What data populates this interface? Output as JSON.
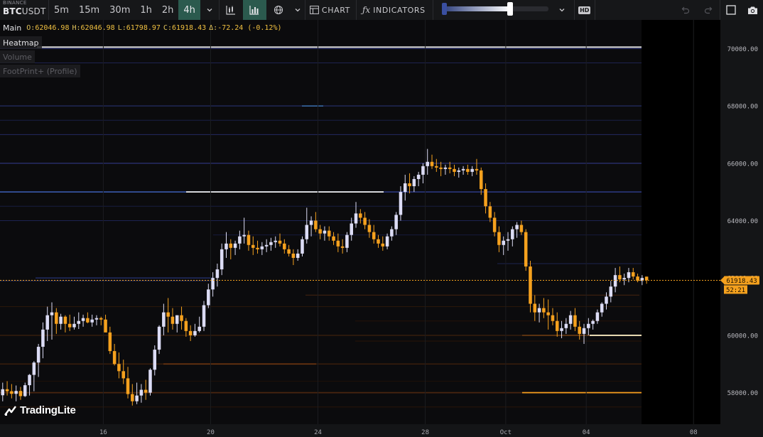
{
  "toolbar": {
    "exchange": "BINANCE",
    "symbol_base": "BTC",
    "symbol_quote": "USDT",
    "timeframes": [
      "5m",
      "15m",
      "30m",
      "1h",
      "2h",
      "4h"
    ],
    "active_timeframe": "4h",
    "chart_label": "CHART",
    "indicators_label": "INDICATORS",
    "hd_badge": "HD",
    "heatmap_slider_level": 0.64
  },
  "legend": {
    "main_label": "Main",
    "o_label": "O:",
    "o_value": "62046.98",
    "h_label": "H:",
    "h_value": "62046.98",
    "l_label": "L:",
    "l_value": "61798.97",
    "c_label": "C:",
    "c_value": "61918.43",
    "d_label": "Δ:",
    "d_value": "-72.24 (-0.12%)"
  },
  "layers": [
    {
      "label": "Heatmap",
      "enabled": true
    },
    {
      "label": "Volume",
      "enabled": false
    },
    {
      "label": "FootPrint+ (Profile)",
      "enabled": false
    }
  ],
  "brand": "TradingLite",
  "colors": {
    "up": "#dcdcf5",
    "down": "#f5a11e",
    "background": "#0b0b0d",
    "toolbar": "#161719",
    "active": "#2b5a4e",
    "price_line": "#f5a11e"
  },
  "chart_data": {
    "type": "candlestick",
    "y_ticks": [
      "58000.00",
      "60000.00",
      "62000.00",
      "64000.00",
      "66000.00",
      "68000.00",
      "70000.00"
    ],
    "y_tick_values": [
      58000,
      60000,
      62000,
      64000,
      66000,
      68000,
      70000
    ],
    "x_ticks": [
      "16",
      "20",
      "24",
      "28",
      "Oct",
      "04",
      "08"
    ],
    "x_tick_days": [
      16,
      20,
      24,
      28,
      31,
      34,
      38
    ],
    "ylim": [
      56900,
      71000
    ],
    "xlim_days": [
      12.15,
      39.0
    ],
    "last_price": "61918.43",
    "countdown": "52:21",
    "candles_per_day": 6,
    "first_candle_day": 12.25,
    "ohlc": [
      [
        57910,
        58350,
        57700,
        58120
      ],
      [
        58120,
        58400,
        57900,
        58050
      ],
      [
        58050,
        58300,
        57800,
        57960
      ],
      [
        57960,
        58250,
        57700,
        58060
      ],
      [
        58060,
        58200,
        57750,
        57880
      ],
      [
        57880,
        58350,
        57850,
        58260
      ],
      [
        58260,
        58650,
        57900,
        58620
      ],
      [
        58620,
        59100,
        58050,
        59050
      ],
      [
        59050,
        59700,
        58550,
        59600
      ],
      [
        59600,
        60450,
        59200,
        60200
      ],
      [
        60200,
        61000,
        59800,
        60700
      ],
      [
        60700,
        61150,
        59850,
        60800
      ],
      [
        60800,
        60950,
        60050,
        60400
      ],
      [
        60400,
        60750,
        60200,
        60650
      ],
      [
        60650,
        60700,
        60100,
        60400
      ],
      [
        60400,
        60720,
        60150,
        60280
      ],
      [
        60280,
        60650,
        60200,
        60400
      ],
      [
        60400,
        60800,
        60220,
        60500
      ],
      [
        60500,
        60720,
        60300,
        60600
      ],
      [
        60600,
        60800,
        60420,
        60450
      ],
      [
        60450,
        60720,
        60300,
        60550
      ],
      [
        60550,
        60700,
        60350,
        60600
      ],
      [
        60600,
        60650,
        60350,
        60550
      ],
      [
        60550,
        60720,
        60250,
        60100
      ],
      [
        60100,
        60300,
        59350,
        59450
      ],
      [
        59450,
        59700,
        58950,
        59000
      ],
      [
        59000,
        59400,
        58500,
        58750
      ],
      [
        58750,
        59150,
        58300,
        58500
      ],
      [
        58500,
        58900,
        57800,
        57950
      ],
      [
        57950,
        58300,
        57550,
        57700
      ],
      [
        57700,
        58350,
        57600,
        57900
      ],
      [
        57900,
        58300,
        57650,
        58100
      ],
      [
        58100,
        58450,
        57750,
        58000
      ],
      [
        58000,
        58850,
        57900,
        58800
      ],
      [
        58800,
        59650,
        58600,
        59500
      ],
      [
        59500,
        60350,
        59350,
        60300
      ],
      [
        60300,
        61100,
        60000,
        60800
      ],
      [
        60800,
        61300,
        60100,
        60650
      ],
      [
        60650,
        60950,
        60200,
        60400
      ],
      [
        60400,
        60700,
        60100,
        60700
      ],
      [
        60700,
        61000,
        60200,
        60500
      ],
      [
        60500,
        60600,
        59950,
        60150
      ],
      [
        60150,
        60350,
        59800,
        60000
      ],
      [
        60000,
        60400,
        59950,
        60150
      ],
      [
        60150,
        60650,
        60100,
        60300
      ],
      [
        60300,
        61200,
        60150,
        61050
      ],
      [
        61050,
        61800,
        60950,
        61600
      ],
      [
        61600,
        62200,
        61350,
        62000
      ],
      [
        62000,
        62500,
        61700,
        62300
      ],
      [
        62300,
        63200,
        62100,
        63000
      ],
      [
        63000,
        63600,
        62700,
        63200
      ],
      [
        63200,
        63350,
        62650,
        63050
      ],
      [
        63050,
        63300,
        62800,
        63200
      ],
      [
        63200,
        63650,
        63000,
        63450
      ],
      [
        63450,
        64100,
        63200,
        63500
      ],
      [
        63500,
        63650,
        62950,
        63150
      ],
      [
        63150,
        63450,
        62800,
        63050
      ],
      [
        63050,
        63300,
        62850,
        63000
      ],
      [
        63000,
        63250,
        62800,
        63100
      ],
      [
        63100,
        63350,
        62900,
        63150
      ],
      [
        63150,
        63400,
        62950,
        63250
      ],
      [
        63250,
        63450,
        63050,
        63300
      ],
      [
        63300,
        63550,
        63100,
        63200
      ],
      [
        63200,
        63350,
        62850,
        63000
      ],
      [
        63000,
        63150,
        62750,
        62850
      ],
      [
        62850,
        63000,
        62450,
        62700
      ],
      [
        62700,
        63000,
        62600,
        62850
      ],
      [
        62850,
        63450,
        62750,
        63350
      ],
      [
        63350,
        64450,
        63200,
        63850
      ],
      [
        63850,
        64150,
        63450,
        64000
      ],
      [
        64000,
        64300,
        63600,
        63700
      ],
      [
        63700,
        63850,
        63350,
        63550
      ],
      [
        63550,
        63800,
        63300,
        63650
      ],
      [
        63650,
        63800,
        63300,
        63450
      ],
      [
        63450,
        63600,
        63150,
        63300
      ],
      [
        63300,
        63550,
        62900,
        63100
      ],
      [
        63100,
        63350,
        62850,
        63050
      ],
      [
        63050,
        63600,
        62900,
        63500
      ],
      [
        63500,
        64100,
        63300,
        63900
      ],
      [
        63900,
        64650,
        63750,
        64250
      ],
      [
        64250,
        64400,
        63900,
        64100
      ],
      [
        64100,
        64300,
        63700,
        63850
      ],
      [
        63850,
        64050,
        63400,
        63600
      ],
      [
        63600,
        63850,
        63200,
        63350
      ],
      [
        63350,
        63500,
        63050,
        63200
      ],
      [
        63200,
        63450,
        62950,
        63100
      ],
      [
        63100,
        63550,
        63000,
        63450
      ],
      [
        63450,
        63800,
        63300,
        63700
      ],
      [
        63700,
        64300,
        63500,
        64200
      ],
      [
        64200,
        65200,
        64000,
        65000
      ],
      [
        65000,
        65600,
        64700,
        65300
      ],
      [
        65300,
        65650,
        64950,
        65200
      ],
      [
        65200,
        65550,
        65000,
        65450
      ],
      [
        65450,
        65700,
        65200,
        65600
      ],
      [
        65600,
        66000,
        65300,
        65900
      ],
      [
        65900,
        66500,
        65600,
        66050
      ],
      [
        66050,
        66300,
        65800,
        65900
      ],
      [
        65900,
        66150,
        65700,
        65850
      ],
      [
        65850,
        66050,
        65550,
        65800
      ],
      [
        65800,
        65950,
        65600,
        65850
      ],
      [
        65850,
        66050,
        65650,
        65800
      ],
      [
        65800,
        65950,
        65550,
        65700
      ],
      [
        65700,
        65850,
        65500,
        65750
      ],
      [
        65750,
        65900,
        65600,
        65800
      ],
      [
        65800,
        65950,
        65600,
        65700
      ],
      [
        65700,
        65900,
        65550,
        65800
      ],
      [
        65800,
        66150,
        65600,
        65750
      ],
      [
        65750,
        65850,
        64900,
        65100
      ],
      [
        65100,
        65300,
        64250,
        64500
      ],
      [
        64500,
        64650,
        63950,
        64100
      ],
      [
        64100,
        64300,
        63450,
        63600
      ],
      [
        63600,
        63800,
        62900,
        63150
      ],
      [
        63150,
        63450,
        62800,
        63300
      ],
      [
        63300,
        63600,
        62950,
        63350
      ],
      [
        63350,
        63800,
        63100,
        63700
      ],
      [
        63700,
        63950,
        63400,
        63850
      ],
      [
        63850,
        64000,
        63500,
        63600
      ],
      [
        63600,
        63700,
        62250,
        62400
      ],
      [
        62400,
        62600,
        60800,
        61100
      ],
      [
        61100,
        61400,
        60500,
        60800
      ],
      [
        60800,
        61100,
        60450,
        60950
      ],
      [
        60950,
        61300,
        60600,
        60800
      ],
      [
        60800,
        61250,
        60200,
        60700
      ],
      [
        60700,
        60950,
        60350,
        60500
      ],
      [
        60500,
        60800,
        59950,
        60150
      ],
      [
        60150,
        60500,
        59900,
        60250
      ],
      [
        60250,
        60600,
        60050,
        60400
      ],
      [
        60400,
        60850,
        60200,
        60700
      ],
      [
        60700,
        60950,
        60150,
        60300
      ],
      [
        60300,
        60500,
        59850,
        60050
      ],
      [
        60050,
        60400,
        59700,
        60250
      ],
      [
        60250,
        60600,
        60000,
        60400
      ],
      [
        60400,
        60550,
        60200,
        60500
      ],
      [
        60500,
        60900,
        60400,
        60800
      ],
      [
        60800,
        61150,
        60650,
        61100
      ],
      [
        61100,
        61500,
        60900,
        61350
      ],
      [
        61350,
        61900,
        61150,
        61700
      ],
      [
        61700,
        62350,
        61500,
        62100
      ],
      [
        62100,
        62400,
        61850,
        61950
      ],
      [
        61950,
        62150,
        61750,
        62000
      ],
      [
        62000,
        62350,
        61850,
        62200
      ],
      [
        62200,
        62350,
        61950,
        62050
      ],
      [
        62050,
        62150,
        61850,
        61900
      ],
      [
        61900,
        62100,
        61750,
        62000
      ],
      [
        62046.98,
        62046.98,
        61798.97,
        61918.43
      ]
    ]
  }
}
